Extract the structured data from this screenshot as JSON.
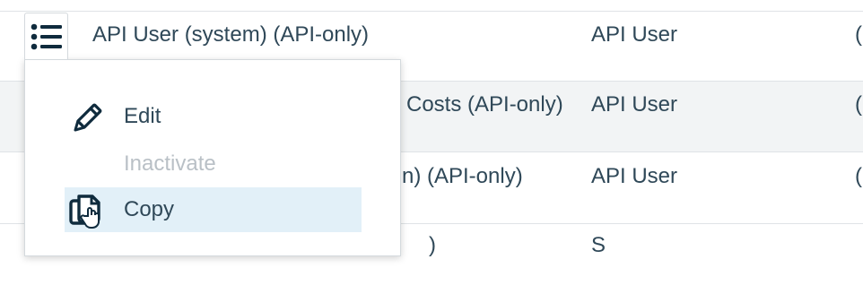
{
  "table": {
    "rows": [
      {
        "name": "API User (system) (API-only)",
        "role": "API User",
        "edge": "("
      },
      {
        "name": "Costs (API-only)",
        "role": "API User",
        "edge": "("
      },
      {
        "name": "n) (API-only)",
        "role": "API User",
        "edge": "("
      },
      {
        "name": ")",
        "role": "S",
        "edge": ""
      }
    ]
  },
  "row_actions_menu": {
    "trigger_icon": "list-icon",
    "items": [
      {
        "label": "Edit",
        "icon": "pencil-icon",
        "enabled": true
      },
      {
        "label": "Inactivate",
        "icon": "",
        "enabled": false
      },
      {
        "label": "Copy",
        "icon": "copy-icon",
        "enabled": true,
        "hovered": true
      }
    ]
  },
  "colors": {
    "text": "#2f4858",
    "disabled_text": "#b9c0c6",
    "hover_bg": "#e2f0f8",
    "alt_row_bg": "#f2f4f5",
    "border": "#dfe3e6"
  }
}
